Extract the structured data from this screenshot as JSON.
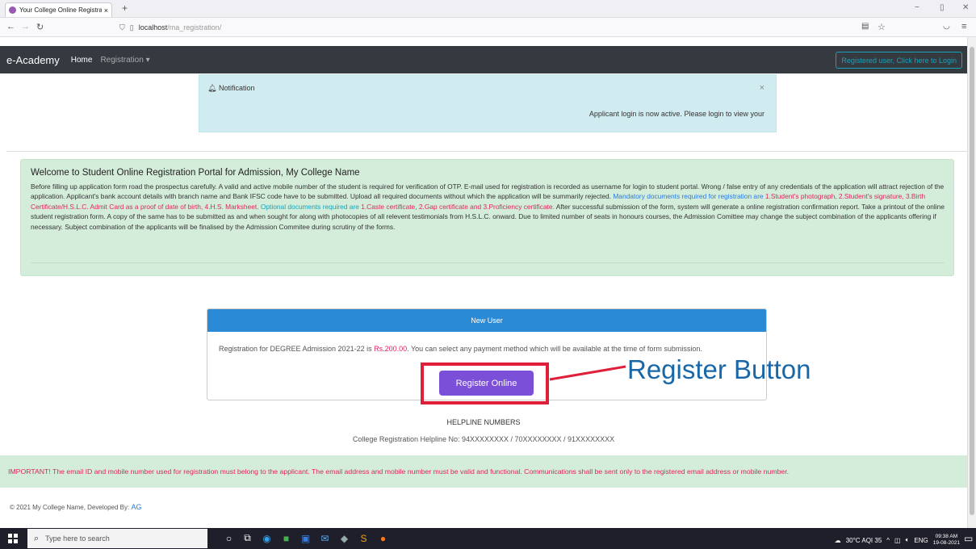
{
  "browser": {
    "tab_title": "Your College Online Registratio",
    "tab_close": "×",
    "new_tab": "+",
    "url_host": "localhost",
    "url_path": "/ma_registration/",
    "win_min": "−",
    "win_max": "▯",
    "win_close": "✕"
  },
  "nav": {
    "brand": "e-Academy",
    "home": "Home",
    "registration": "Registration ▾",
    "login_button": "Registered user, Click here to Login"
  },
  "notification": {
    "header": "Notification",
    "close": "×",
    "message": "Applicant login is now active. Please login to view your"
  },
  "welcome": {
    "title": "Welcome to Student Online Registration Portal for Admission, My College Name",
    "para1": "Before filling up application form road the prospectus carefully. A valid and active mobile number of the student is required for verification of OTP. E-mail used for registration is recorded as username for login to student portal. Wrong / false entry of any credentials of the application will attract rejection of the application. Applicant's bank account details with branch name and Bank IFSC code have to be submitted. Upload all required documents without which the application will be summarily rejected.",
    "mandatory": "Mandatory documents required for registration are",
    "mandatory_list": "1.Student's photograph, 2.Student's signature, 3.Birth Certificate/H.S.L.C. Admit Card as a proof of date of birth, 4.H.S. Marksheet.",
    "optional": "Optional documents required are",
    "optional_list": "1.Caste certificate, 2.Gap certificate and 3.Proficiency certificate.",
    "para2": "After successful submission of the form, system will generate a online registration confirmation report. Take a printout of the online student registration form. A copy of the same has to be submitted as and when sought for along with photocopies of all relevent testimonials from H.S.L.C. onward. Due to limited number of seats in honours courses, the Admission Comittee may change the subject combination of the applicants offering if necessary. Subject combination of the applicants will be finalised by the Admission Commitee during scrutiny of the forms."
  },
  "new_user": {
    "header": "New User",
    "text_before": "Registration for DEGREE Admission 2021-22 is",
    "fee": "Rs.200.00",
    "text_after": ". You can select any payment method which will be available at the time of form submission.",
    "register_button": "Register Online",
    "annotation": "Register Button"
  },
  "helpline": {
    "heading": "HELPLINE NUMBERS",
    "numbers": "College Registration Helpline No: 94XXXXXXXX / 70XXXXXXXX / 91XXXXXXXX"
  },
  "important": "IMPORTANT! The email ID and mobile number used for registration must belong to the applicant. The email address and mobile number must be valid and functional. Communications shall be sent only to the registered email address or mobile number.",
  "footer": {
    "text": "© 2021 My College Name, Developed By:",
    "dev": "AG"
  },
  "taskbar": {
    "search_placeholder": "Type here to search",
    "weather": "30°C  AQI 35",
    "lang": "ENG",
    "time": "09:38 AM",
    "date": "19-08-2021"
  },
  "colors": {
    "navbar": "#343a40",
    "accent_blue": "#2a8ad6",
    "register_purple": "#7b4fd8",
    "highlight_red": "#e0203a",
    "success_bg": "#d4edda",
    "info_bg": "#d1ecf1"
  }
}
